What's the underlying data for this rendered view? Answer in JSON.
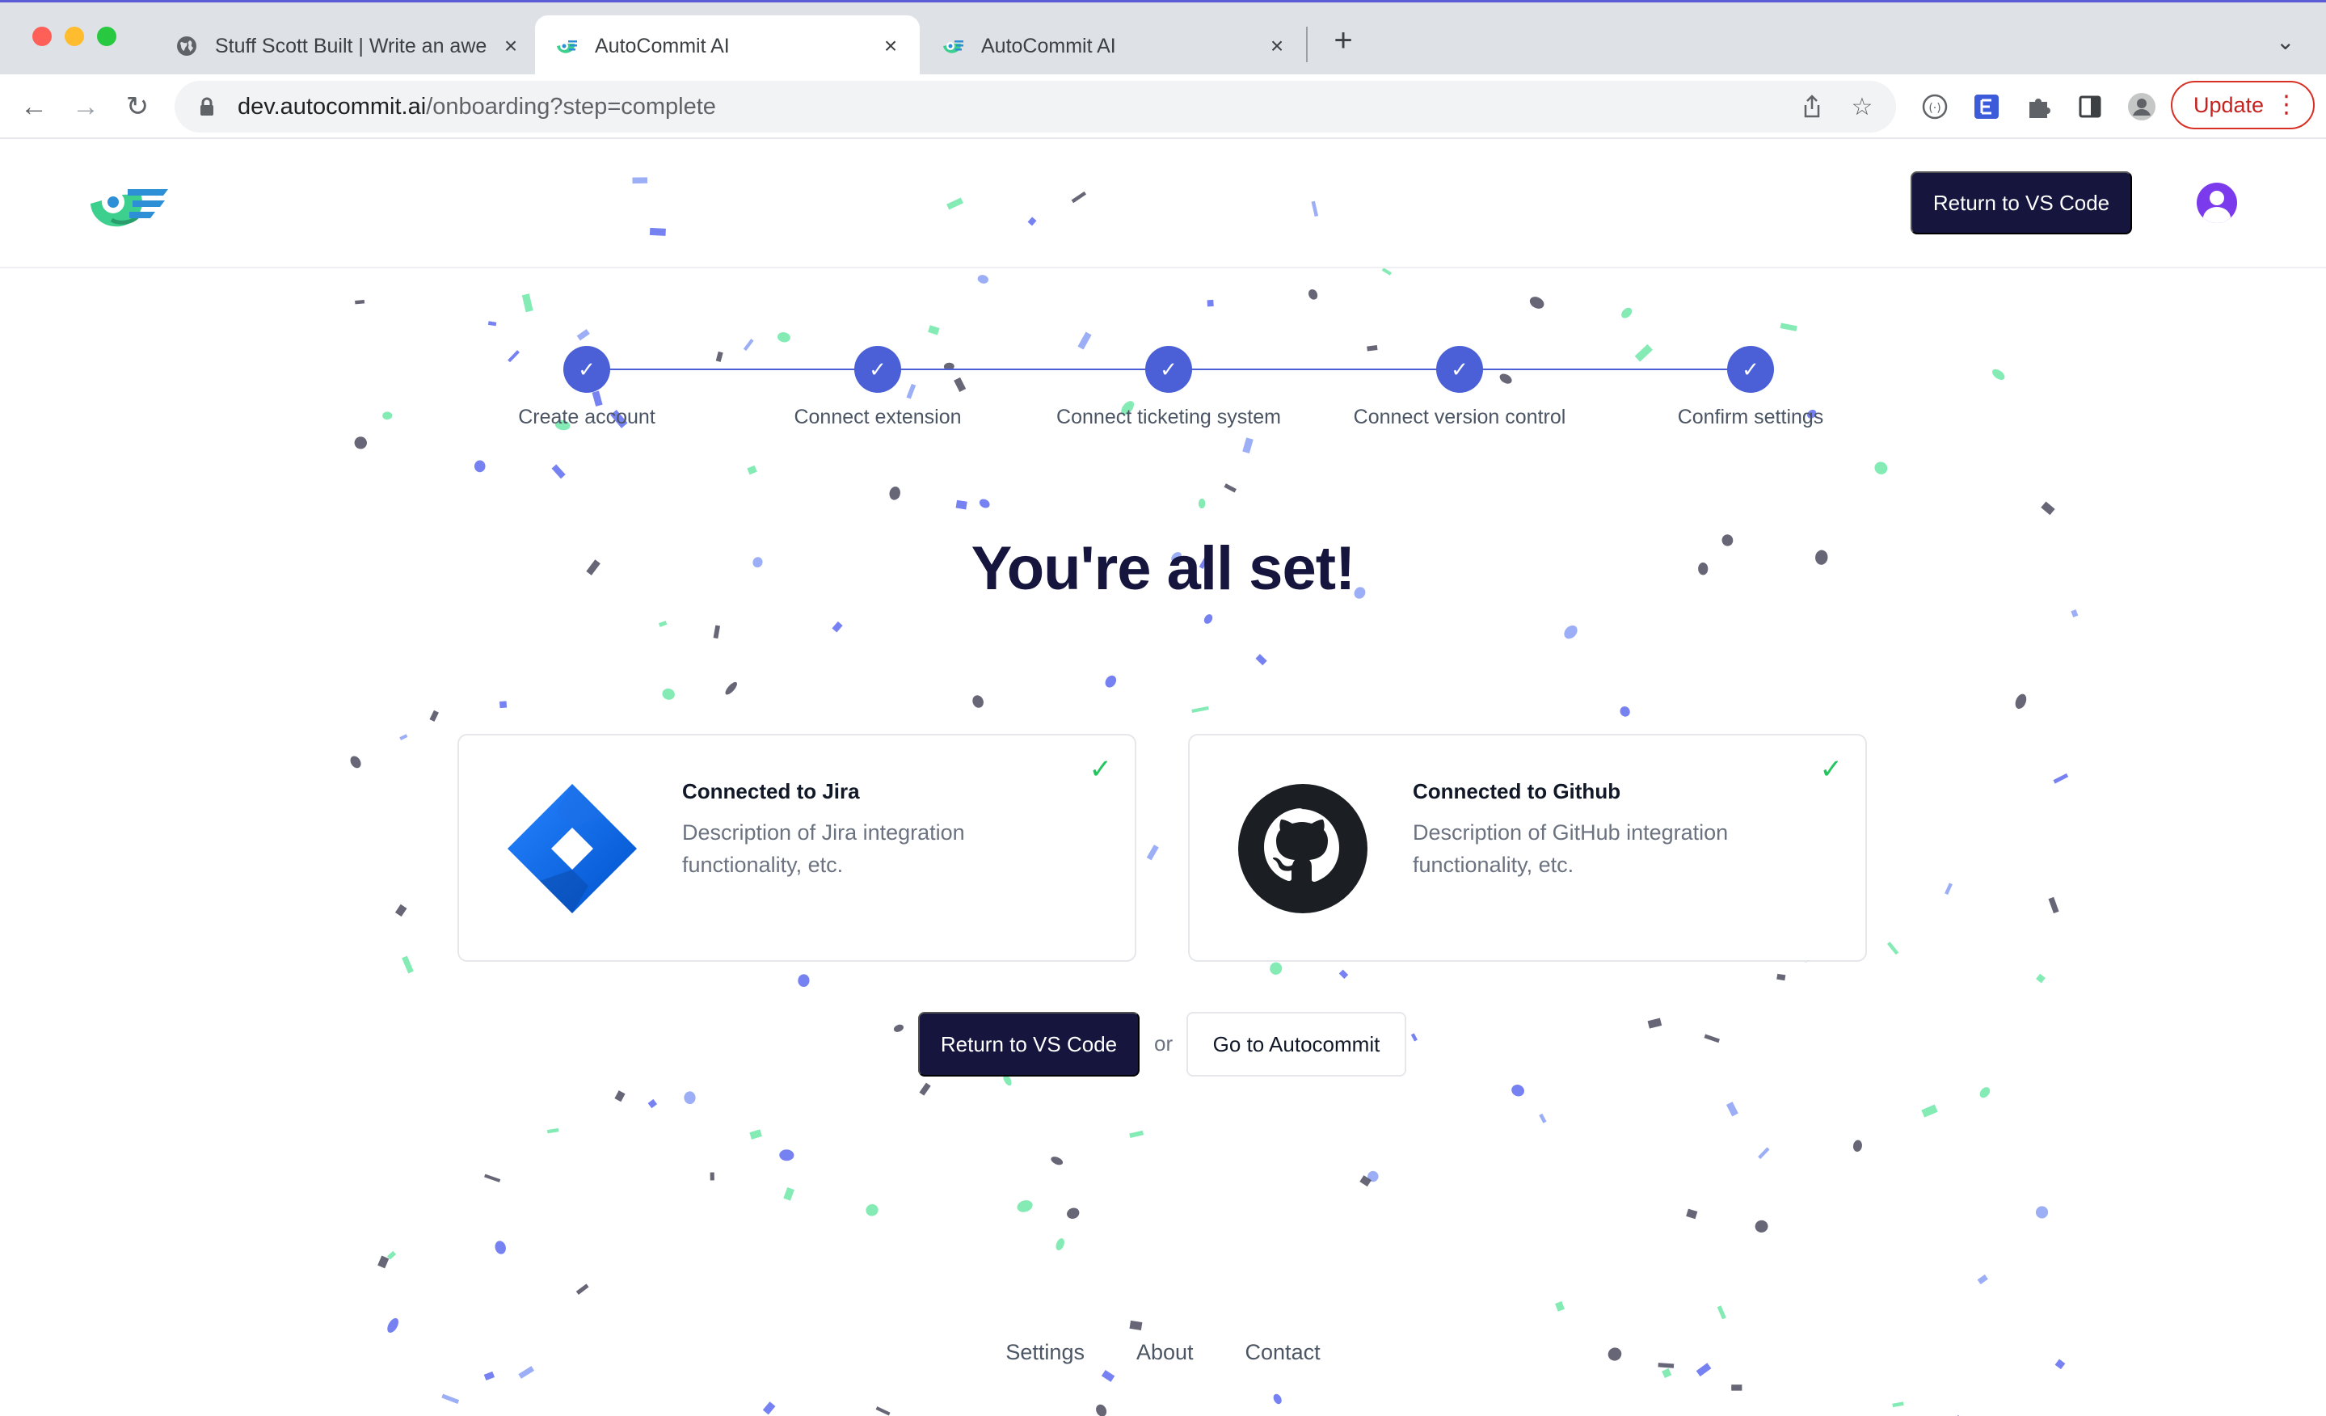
{
  "browser": {
    "tabs": [
      {
        "title": "Stuff Scott Built | Write an awe",
        "favicon": "globe-icon",
        "active": false
      },
      {
        "title": "AutoCommit AI",
        "favicon": "autocommit-logo-icon",
        "active": true
      },
      {
        "title": "AutoCommit AI",
        "favicon": "autocommit-logo-icon",
        "active": false
      }
    ],
    "url_host": "dev.autocommit.ai",
    "url_path": "/onboarding?step=complete",
    "update_label": "Update"
  },
  "header": {
    "return_button": "Return to VS Code"
  },
  "stepper": {
    "steps": [
      {
        "label": "Create account",
        "done": true
      },
      {
        "label": "Connect extension",
        "done": true
      },
      {
        "label": "Connect ticketing system",
        "done": true
      },
      {
        "label": "Connect version control",
        "done": true
      },
      {
        "label": "Confirm settings",
        "done": true
      }
    ],
    "check_glyph": "✓"
  },
  "main": {
    "headline": "You're all set!",
    "cards": [
      {
        "title": "Connected to Jira",
        "description": "Description of Jira integration functionality, etc.",
        "icon": "jira-icon",
        "status": "connected"
      },
      {
        "title": "Connected to Github",
        "description": "Description of GitHub integration functionality, etc.",
        "icon": "github-icon",
        "status": "connected"
      }
    ],
    "primary_button": "Return to VS Code",
    "or_text": "or",
    "secondary_button": "Go to Autocommit"
  },
  "footer": {
    "links": [
      "Settings",
      "About",
      "Contact"
    ]
  },
  "colors": {
    "brand_dark": "#15153e",
    "step_blue": "#4b5fd6",
    "check_green": "#22c55e",
    "confetti": [
      "#5f6cf0",
      "#6ee7a8",
      "#4b4b5e",
      "#8aa0f5"
    ]
  }
}
